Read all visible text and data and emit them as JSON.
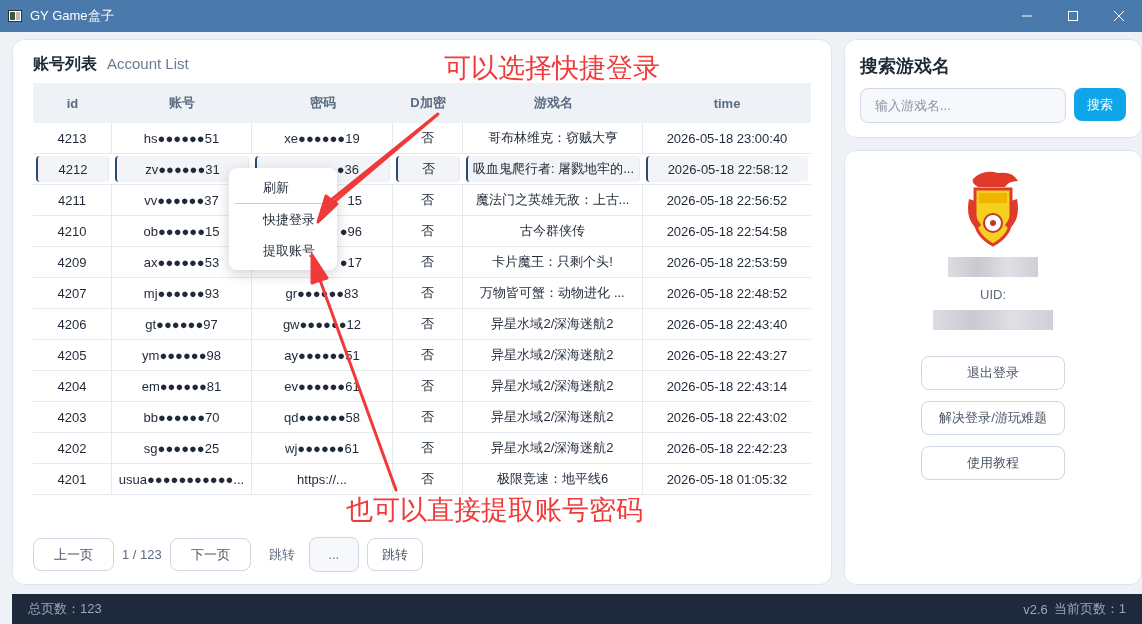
{
  "window": {
    "title": "GY Game盒子"
  },
  "account_list": {
    "title": "账号列表",
    "subtitle": "Account List",
    "columns": [
      "id",
      "账号",
      "密码",
      "D加密",
      "游戏名",
      "time"
    ],
    "rows": [
      {
        "id": "4213",
        "account": "hs●●●●●●51",
        "password": "xe●●●●●●19",
        "encrypted": "否",
        "game": "哥布林维克：窃贼大亨",
        "time": "2026-05-18 23:00:40",
        "selected": false,
        "password_covered": false
      },
      {
        "id": "4212",
        "account": "zv●●●●●●31",
        "password": "●36",
        "encrypted": "否",
        "game": "吸血鬼爬行者: 屠戮地牢的...",
        "time": "2026-05-18 22:58:12",
        "selected": true,
        "password_covered": true
      },
      {
        "id": "4211",
        "account": "vv●●●●●●37",
        "password": "15",
        "encrypted": "否",
        "game": "魔法门之英雄无敌：上古...",
        "time": "2026-05-18 22:56:52",
        "selected": false,
        "password_covered": true
      },
      {
        "id": "4210",
        "account": "ob●●●●●●15",
        "password": "●96",
        "encrypted": "否",
        "game": "古今群侠传",
        "time": "2026-05-18 22:54:58",
        "selected": false,
        "password_covered": true
      },
      {
        "id": "4209",
        "account": "ax●●●●●●53",
        "password": "●17",
        "encrypted": "否",
        "game": "卡片魔王：只剩个头!",
        "time": "2026-05-18 22:53:59",
        "selected": false,
        "password_covered": true
      },
      {
        "id": "4207",
        "account": "mj●●●●●●93",
        "password": "gr●●●●●●83",
        "encrypted": "否",
        "game": "万物皆可蟹：动物进化 ...",
        "time": "2026-05-18 22:48:52",
        "selected": false,
        "password_covered": false
      },
      {
        "id": "4206",
        "account": "gt●●●●●●97",
        "password": "gw●●●●●●12",
        "encrypted": "否",
        "game": "异星水域2/深海迷航2",
        "time": "2026-05-18 22:43:40",
        "selected": false,
        "password_covered": false
      },
      {
        "id": "4205",
        "account": "ym●●●●●●98",
        "password": "ay●●●●●●51",
        "encrypted": "否",
        "game": "异星水域2/深海迷航2",
        "time": "2026-05-18 22:43:27",
        "selected": false,
        "password_covered": false
      },
      {
        "id": "4204",
        "account": "em●●●●●●81",
        "password": "ev●●●●●●61",
        "encrypted": "否",
        "game": "异星水域2/深海迷航2",
        "time": "2026-05-18 22:43:14",
        "selected": false,
        "password_covered": false
      },
      {
        "id": "4203",
        "account": "bb●●●●●●70",
        "password": "qd●●●●●●58",
        "encrypted": "否",
        "game": "异星水域2/深海迷航2",
        "time": "2026-05-18 22:43:02",
        "selected": false,
        "password_covered": false
      },
      {
        "id": "4202",
        "account": "sg●●●●●●25",
        "password": "wj●●●●●●61",
        "encrypted": "否",
        "game": "异星水域2/深海迷航2",
        "time": "2026-05-18 22:42:23",
        "selected": false,
        "password_covered": false
      },
      {
        "id": "4201",
        "account": "usua●●●●●●●●●●●...",
        "password": "https://...",
        "encrypted": "否",
        "game": "极限竞速：地平线6",
        "time": "2026-05-18 01:05:32",
        "selected": false,
        "password_covered": false
      }
    ],
    "context_menu": {
      "items": [
        "刷新",
        "快捷登录",
        "提取账号"
      ]
    },
    "pagination": {
      "prev": "上一页",
      "page": "1 / 123",
      "next": "下一页",
      "jump_label": "跳转",
      "jump_placeholder": "...",
      "jump_button": "跳转"
    }
  },
  "search": {
    "title": "搜索游戏名",
    "placeholder": "输入游戏名...",
    "button": "搜索"
  },
  "profile": {
    "uid_label": "UID:",
    "buttons": [
      "退出登录",
      "解决登录/游玩难题",
      "使用教程"
    ]
  },
  "status_bar": {
    "total": "总页数：123",
    "version": "v2.6",
    "current": "当前页数：1"
  },
  "annotations": [
    "可以选择快捷登录",
    "也可以直接提取账号密码"
  ]
}
